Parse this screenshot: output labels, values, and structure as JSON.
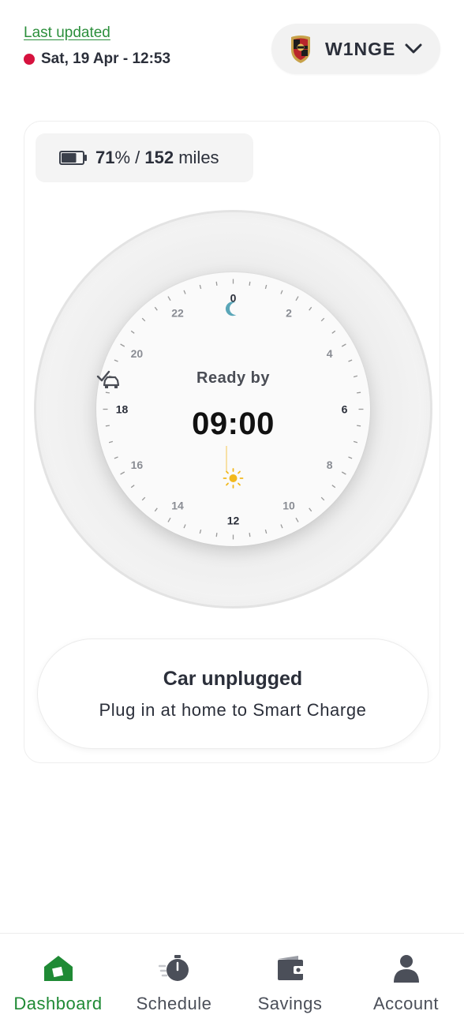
{
  "header": {
    "last_updated_label": "Last updated",
    "last_updated_time": "Sat, 19 Apr - 12:53",
    "status_color": "#d6123e"
  },
  "vehicle": {
    "name": "W1NGE",
    "logo_icon": "porsche-crest-icon",
    "dropdown_icon": "chevron-down-icon"
  },
  "battery": {
    "percent": "71",
    "percent_suffix": "%",
    "separator": " / ",
    "range": "152",
    "range_unit": " miles",
    "level_fraction": 0.71
  },
  "clock": {
    "hour_labels": [
      "0",
      "2",
      "4",
      "6",
      "8",
      "10",
      "12",
      "14",
      "16",
      "18",
      "20",
      "22"
    ],
    "ready_label": "Ready by",
    "ready_time": "09:00",
    "night_icon": "moon-icon",
    "day_icon": "sun-icon",
    "ready_icon": "car-check-icon"
  },
  "status": {
    "title": "Car unplugged",
    "subtitle": "Plug in at home to Smart Charge"
  },
  "nav": {
    "items": [
      {
        "label": "Dashboard",
        "icon": "home-icon",
        "active": true
      },
      {
        "label": "Schedule",
        "icon": "stopwatch-icon",
        "active": false
      },
      {
        "label": "Savings",
        "icon": "wallet-icon",
        "active": false
      },
      {
        "label": "Account",
        "icon": "person-icon",
        "active": false
      }
    ]
  },
  "colors": {
    "accent_green": "#1f8a35",
    "moon": "#5aa6b8",
    "sun": "#f2b81c",
    "text_dark": "#2b2f3a"
  }
}
